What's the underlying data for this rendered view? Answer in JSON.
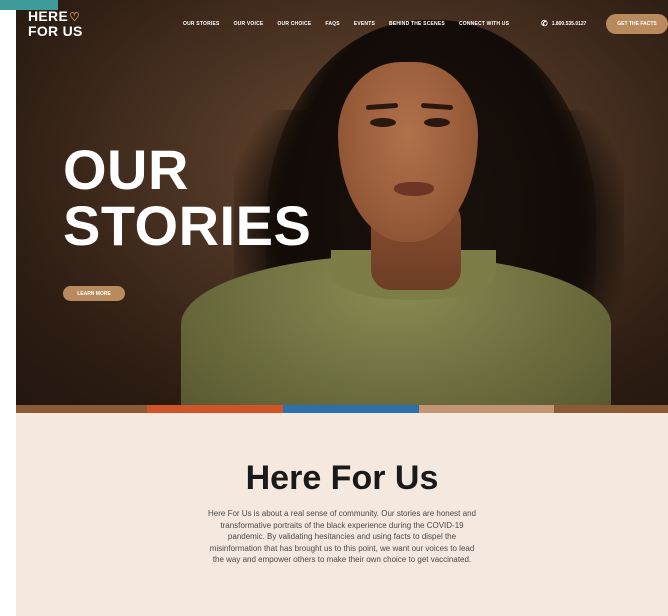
{
  "brand": {
    "logo_line1": "HERE",
    "logo_line2": "FOR US",
    "accent": "#b98a5e",
    "corner_accent": "#3f9b9a"
  },
  "nav": {
    "items": [
      "OUR STORIES",
      "OUR VOICE",
      "OUR CHOICE",
      "FAQS",
      "EVENTS",
      "BEHIND THE SCENES",
      "CONNECT WITH US"
    ],
    "phone": "1.800.535.0127",
    "cta_label": "GET THE FACTS"
  },
  "hero": {
    "headline_line1": "OUR",
    "headline_line2": "STORIES",
    "button_label": "LEARN MORE"
  },
  "stripe_colors": [
    "#8b5a36",
    "#d05427",
    "#2f6fae",
    "#c39572",
    "#8b5a36"
  ],
  "about": {
    "title": "Here For Us",
    "body": "Here For Us is about a real sense of community. Our stories are honest and transformative portraits of the black experience during the COVID-19 pandemic. By validating hesitancies and using facts to dispel the misinformation that has brought us to this point, we want our voices to lead the way and empower others to make their own choice to get vaccinated."
  }
}
